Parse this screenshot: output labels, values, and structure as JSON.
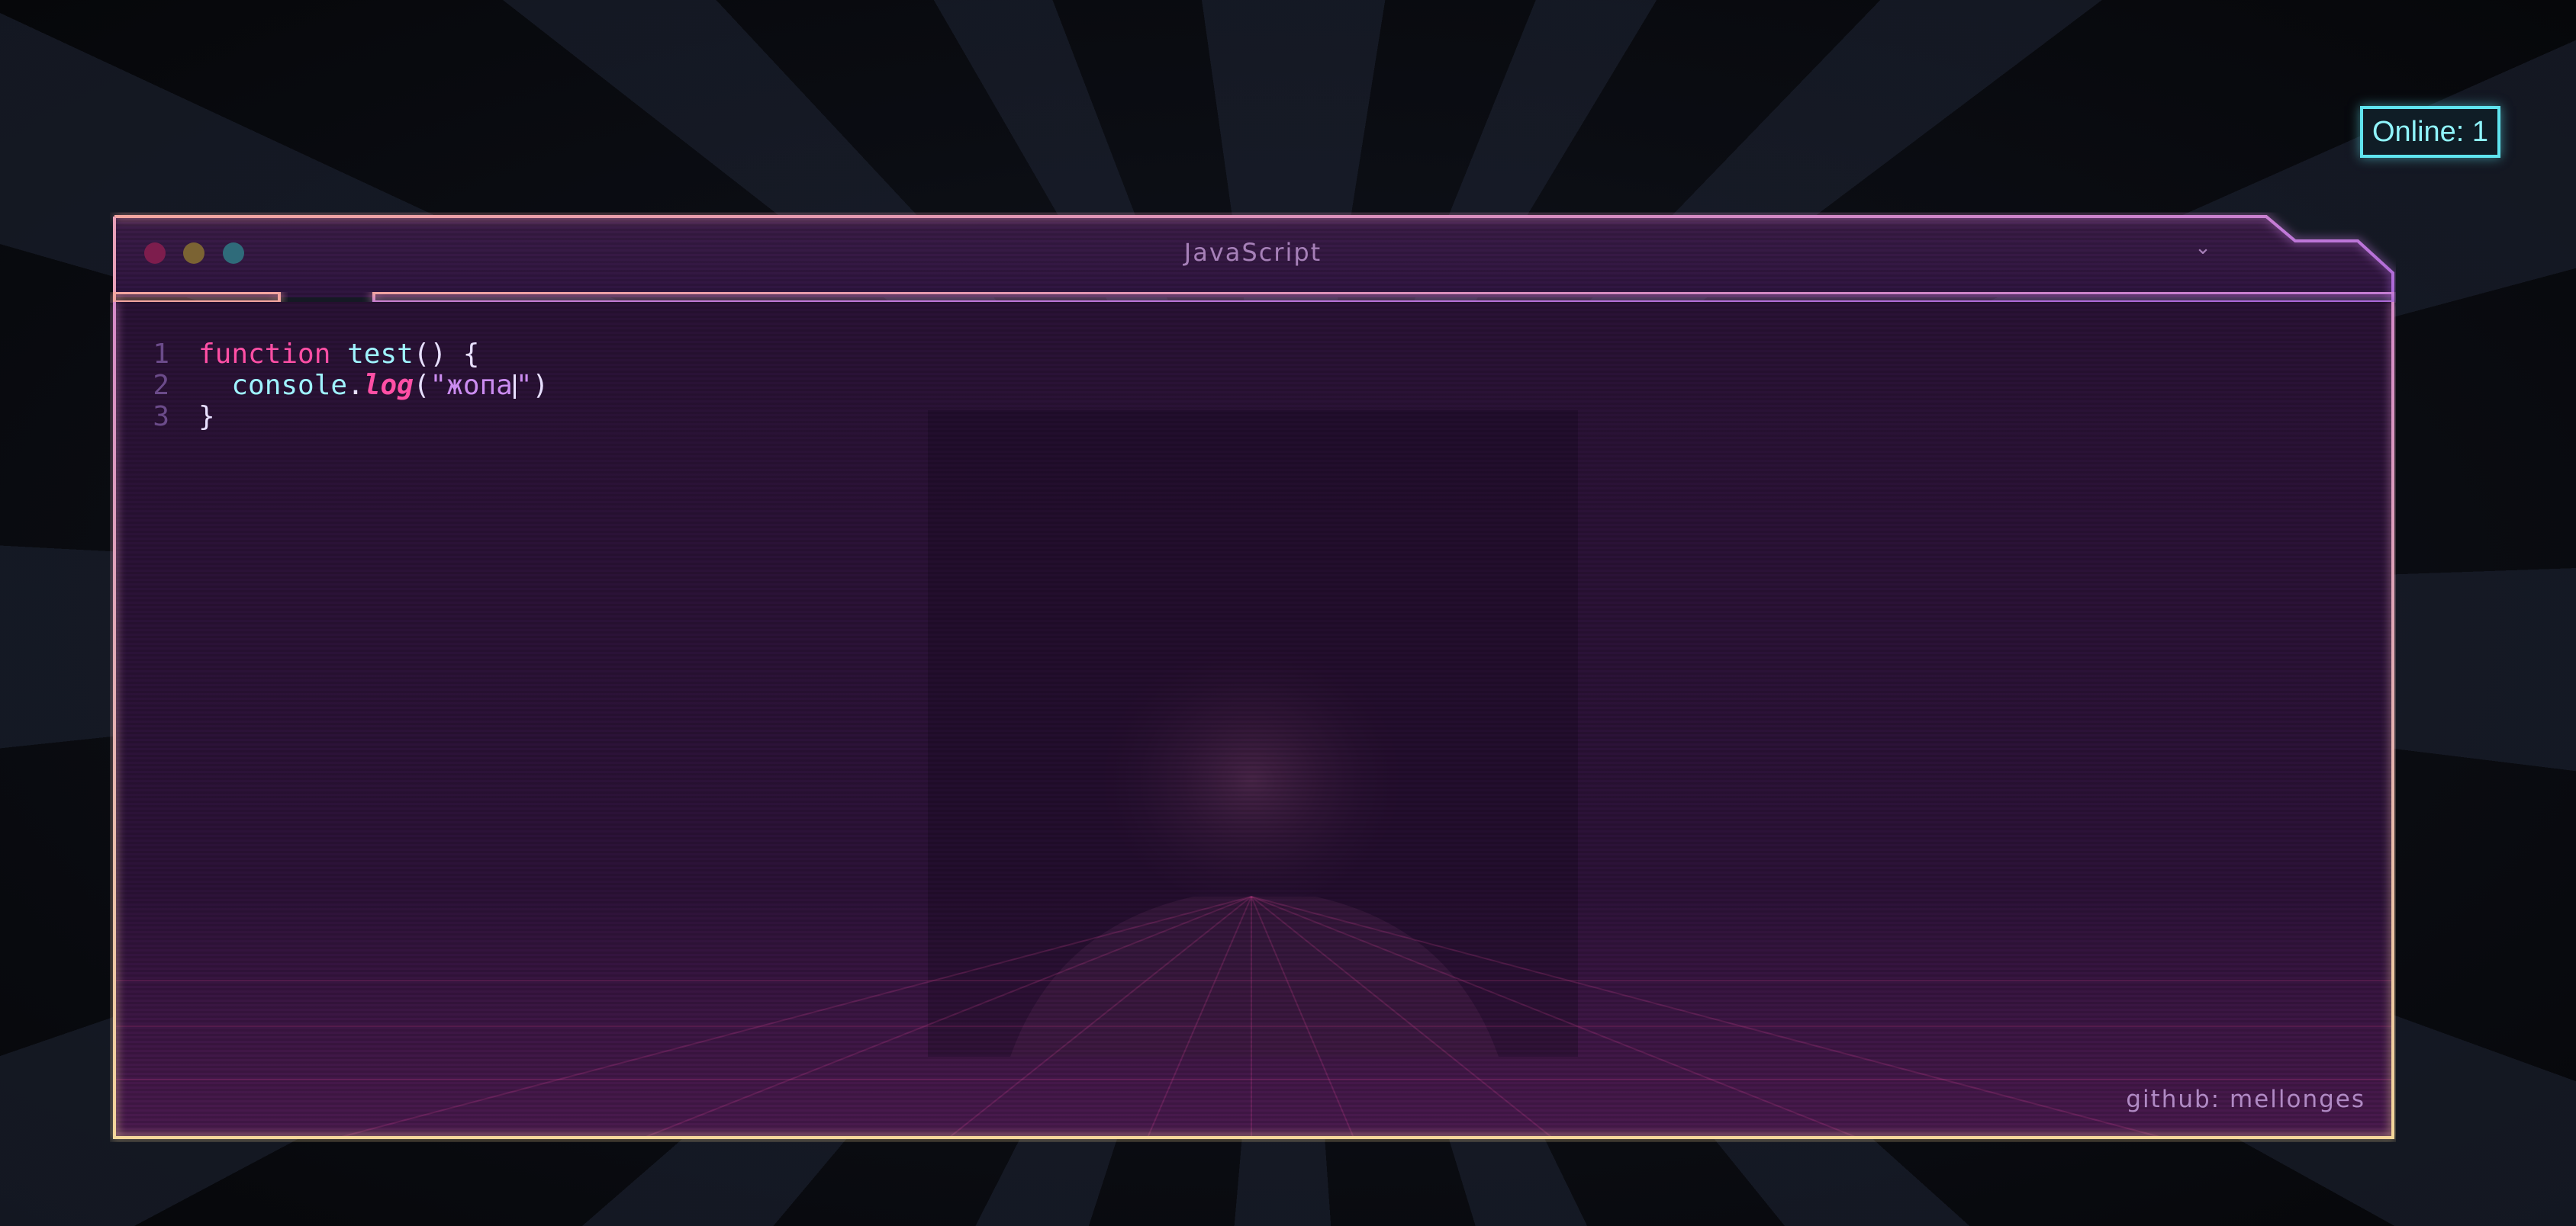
{
  "online_badge": {
    "label": "Online: 1"
  },
  "window": {
    "title": "JavaScript",
    "footer": "github: mellonges"
  },
  "editor": {
    "lines": [
      {
        "number": "1",
        "tokens": {
          "keyword": "function",
          "name": "test",
          "rest": "() {"
        }
      },
      {
        "number": "2",
        "tokens": {
          "object": "console",
          "dot": ".",
          "method": "log",
          "open": "(",
          "string_value": "\"жопа",
          "close_quote": "\"",
          "close": ")"
        }
      },
      {
        "number": "3",
        "tokens": {
          "text": "}"
        }
      }
    ]
  },
  "colors": {
    "accent_cyan": "#5fe4ef",
    "accent_pink": "#ff4fa5",
    "accent_purple": "#a966d8",
    "accent_peach": "#f3a6a0"
  }
}
